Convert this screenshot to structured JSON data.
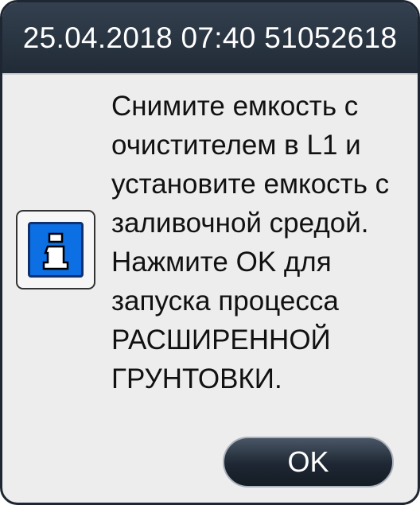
{
  "dialog": {
    "title": "25.04.2018 07:40 51052618",
    "icon": "info-icon",
    "message_lines": [
      "Снимите емкость с",
      "очистителем в L1 и",
      "установите емкость с",
      "заливочной средой.",
      "Нажмите OK для",
      "запуска процесса",
      "РАСШИРЕННОЙ",
      "ГРУНТОВКИ."
    ],
    "ok_label": "OK"
  },
  "colors": {
    "titlebar": "#2a3542",
    "dialog_background": "#ededed",
    "info_icon_blue": "#0d6fe4",
    "button_dark": "#1e2733"
  }
}
